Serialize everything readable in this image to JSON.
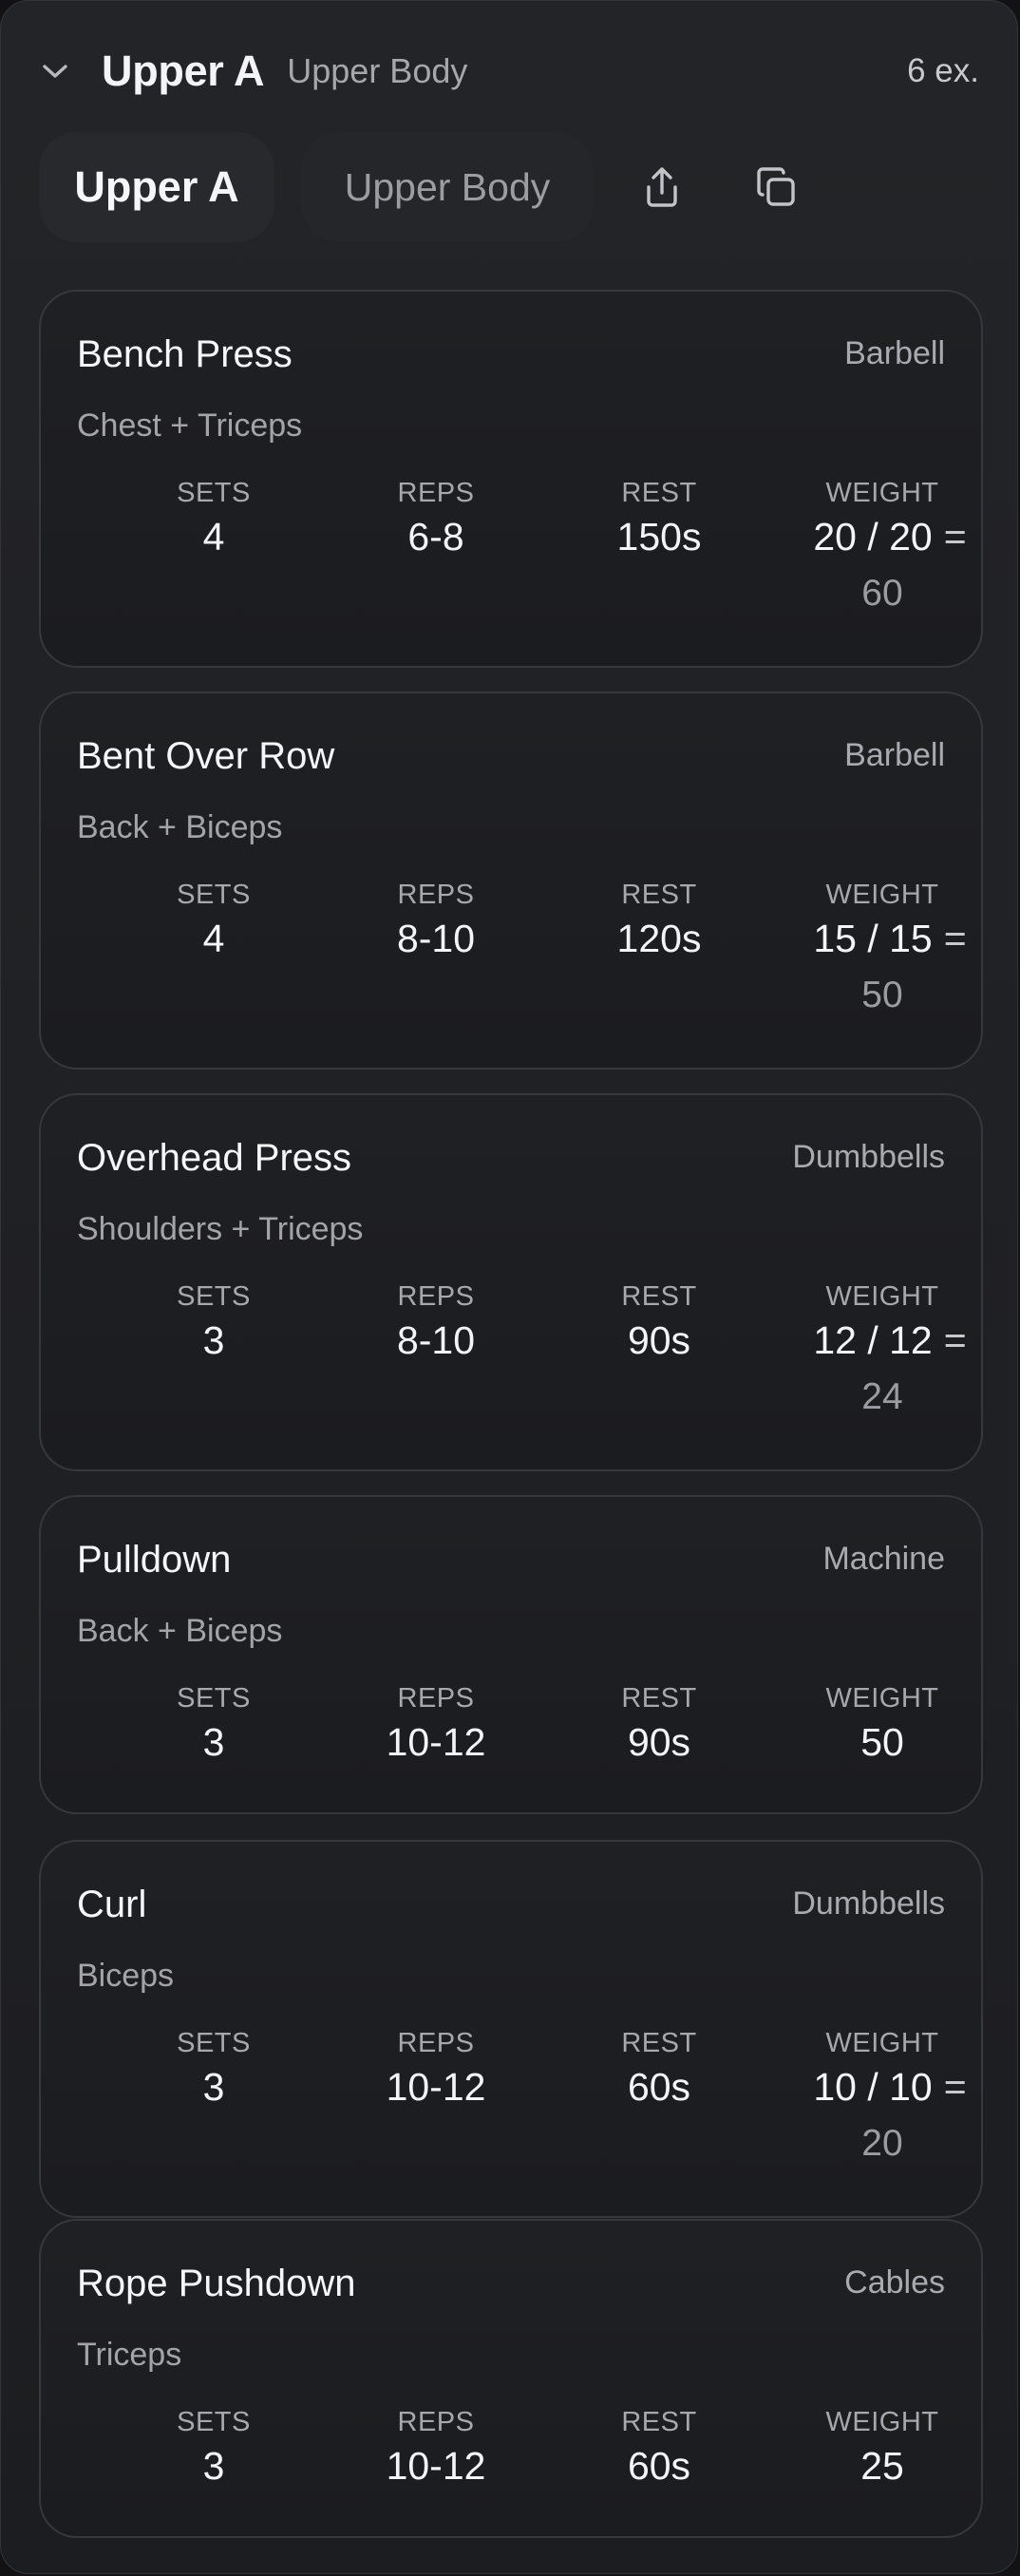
{
  "workout": {
    "title": "Upper A",
    "subtitle": "Upper Body",
    "count": "6 ex.",
    "name_value": "Upper A",
    "description_value": "Upper Body"
  },
  "icons": {
    "collapse": "chevron-down-icon",
    "share": "share-icon",
    "copy": "copy-icon"
  },
  "labels": {
    "sets": "SETS",
    "reps": "REPS",
    "rest": "REST",
    "weight": "WEIGHT"
  },
  "exercises": [
    {
      "name": "Bench Press",
      "equipment": "Barbell",
      "muscles": "Chest + Triceps",
      "sets": "4",
      "reps": "6-8",
      "rest": "150s",
      "weight_split": "20 / 20",
      "eq": "=",
      "weight_total": "60"
    },
    {
      "name": "Bent Over Row",
      "equipment": "Barbell",
      "muscles": "Back + Biceps",
      "sets": "4",
      "reps": "8-10",
      "rest": "120s",
      "weight_split": "15 / 15",
      "eq": "=",
      "weight_total": "50"
    },
    {
      "name": "Overhead Press",
      "equipment": "Dumbbells",
      "muscles": "Shoulders + Triceps",
      "sets": "3",
      "reps": "8-10",
      "rest": "90s",
      "weight_split": "12 / 12",
      "eq": "=",
      "weight_total": "24"
    },
    {
      "name": "Pulldown",
      "equipment": "Machine",
      "muscles": "Back + Biceps",
      "sets": "3",
      "reps": "10-12",
      "rest": "90s",
      "weight": "50"
    },
    {
      "name": "Curl",
      "equipment": "Dumbbells",
      "muscles": "Biceps",
      "sets": "3",
      "reps": "10-12",
      "rest": "60s",
      "weight_split": "10 / 10",
      "eq": "=",
      "weight_total": "20"
    },
    {
      "name": "Rope Pushdown",
      "equipment": "Cables",
      "muscles": "Triceps",
      "sets": "3",
      "reps": "10-12",
      "rest": "60s",
      "weight": "25"
    }
  ]
}
